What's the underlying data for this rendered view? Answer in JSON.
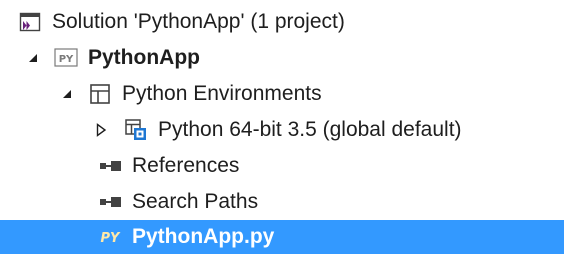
{
  "tree": {
    "solution_label": "Solution 'PythonApp' (1 project)",
    "project_label": "PythonApp",
    "project_badge": "PY",
    "environments_label": "Python Environments",
    "interpreter_label": "Python 64-bit 3.5 (global default)",
    "references_label": "References",
    "search_paths_label": "Search Paths",
    "file_label": "PythonApp.py",
    "file_badge": "PY"
  },
  "colors": {
    "selection": "#3399ff",
    "vs_purple": "#68217a",
    "folder_blue": "#1e77d3"
  }
}
